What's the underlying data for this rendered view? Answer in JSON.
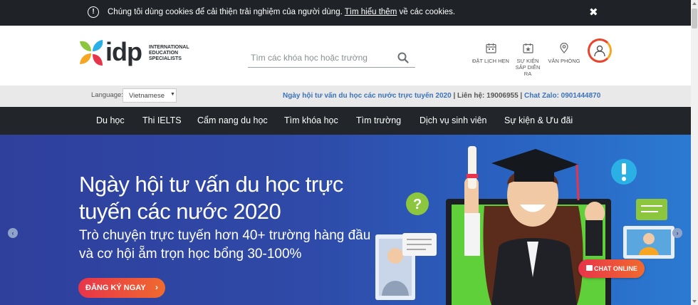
{
  "cookie": {
    "text_before": "Chúng tôi dùng cookies để cải thiện trải nghiệm của người dùng. ",
    "link_text": "Tìm hiểu thêm",
    "text_after": " về các cookies.",
    "close_glyph": "✖"
  },
  "logo": {
    "word": "idp",
    "tagline": [
      "INTERNATIONAL",
      "EDUCATION",
      "SPECIALISTS"
    ]
  },
  "search": {
    "placeholder": "Tìm các khóa học hoặc trường"
  },
  "header_links": [
    {
      "label": "ĐẶT LỊCH HẸN",
      "icon": "calendar-icon"
    },
    {
      "label": "SỰ KIỆN SẮP DIỄN RA",
      "icon": "calendar-star-icon"
    },
    {
      "label": "VĂN PHÒNG",
      "icon": "location-pin-icon"
    }
  ],
  "info_bar": {
    "language_label": "Language:",
    "language_value": "Vietnamese",
    "event_text": "Ngày hội tư vấn du học các nước trực tuyến 2020",
    "separator": " | ",
    "hotline_text": "Liên hệ: 19006955",
    "zalo_text": "Chat Zalo: 0901444870"
  },
  "nav": [
    "Du học",
    "Thi IELTS",
    "Cẩm nang du học",
    "Tìm khóa học",
    "Tìm trường",
    "Dịch vụ sinh viên",
    "Sự kiện & Ưu đãi"
  ],
  "hero": {
    "title": "Ngày hội tư vấn du học trực tuyến các nước 2020",
    "subtitle": "Trò chuyện trực tuyến hơn 40+ trường hàng đầu và cơ hội ẵm trọn học bổng 30-100%",
    "cta_label": "ĐĂNG KÝ NGAY",
    "cta_chevron": "›",
    "arrow_left": "‹",
    "arrow_right": "›"
  },
  "chat": {
    "label": "CHAT ONLINE"
  },
  "colors": {
    "accent_red": "#e8344a",
    "accent_orange": "#f06a2e",
    "link_blue": "#3b73b9",
    "nav_bg": "#22262a",
    "hero_blue": "#2f3f9c"
  }
}
